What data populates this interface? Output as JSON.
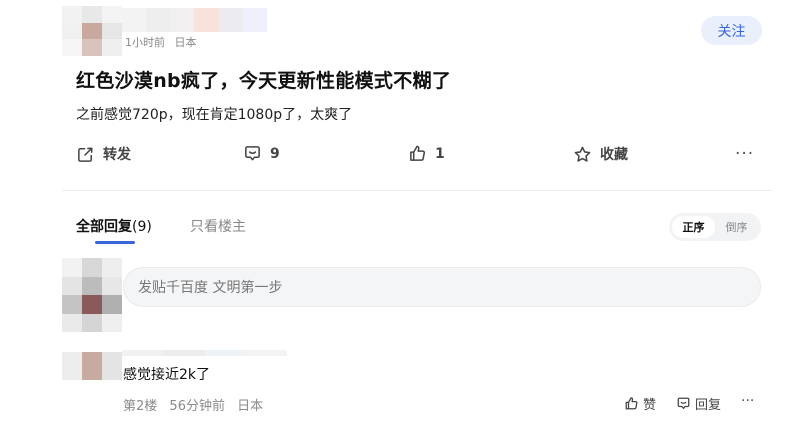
{
  "post": {
    "meta": {
      "time": "1小时前",
      "location": "日本"
    },
    "follow_label": "关注",
    "title": "红色沙漠nb疯了，今天更新性能模式不糊了",
    "body": "之前感觉720p，现在肯定1080p了，太爽了",
    "actions": {
      "share": "转发",
      "comment_count": "9",
      "like_count": "1",
      "favorite": "收藏",
      "more": "···"
    }
  },
  "tabs": {
    "all_label": "全部回复",
    "all_count": "(9)",
    "owner_label": "只看楼主"
  },
  "sort": {
    "asc": "正序",
    "desc": "倒序"
  },
  "composer": {
    "placeholder": "发贴千百度 文明第一步"
  },
  "reply": {
    "text": "感觉接近2k了",
    "floor": "第2楼",
    "time": "56分钟前",
    "location": "日本",
    "like_label": "赞",
    "reply_label": "回复",
    "more": "···"
  },
  "colors": {
    "accent": "#3a66d8",
    "follow_bg": "#e9effb",
    "meta_gray": "#8a8a8a"
  },
  "mosaics": {
    "post_avatar": [
      "#f2f2f2",
      "#e8e8e8",
      "#f4f4f4",
      "#f0f0f0",
      "#c9a99e",
      "#e6e6e6",
      "#f6f6f6",
      "#d8c4bd",
      "#efefef"
    ],
    "post_username": [
      "#f3f3f3",
      "#eeeeee",
      "#f1efef",
      "#f7e3dc",
      "#ececf0",
      "#eef1fb"
    ],
    "composer_avatar": [
      "#f2f2f2",
      "#d7d7d7",
      "#eeeeee",
      "#e4e4e4",
      "#bcbcbc",
      "#e7e7e7",
      "#c4c4c4",
      "#8a5a5a",
      "#b0b0b0",
      "#eaeaea",
      "#d5d5d5",
      "#efefef"
    ],
    "reply_avatar": [
      "#ededed",
      "#c7aaa0",
      "#e4e4e4"
    ],
    "reply_username": [
      "#f1f1f1",
      "#ededed",
      "#eef3f8",
      "#f3f3f3"
    ]
  }
}
